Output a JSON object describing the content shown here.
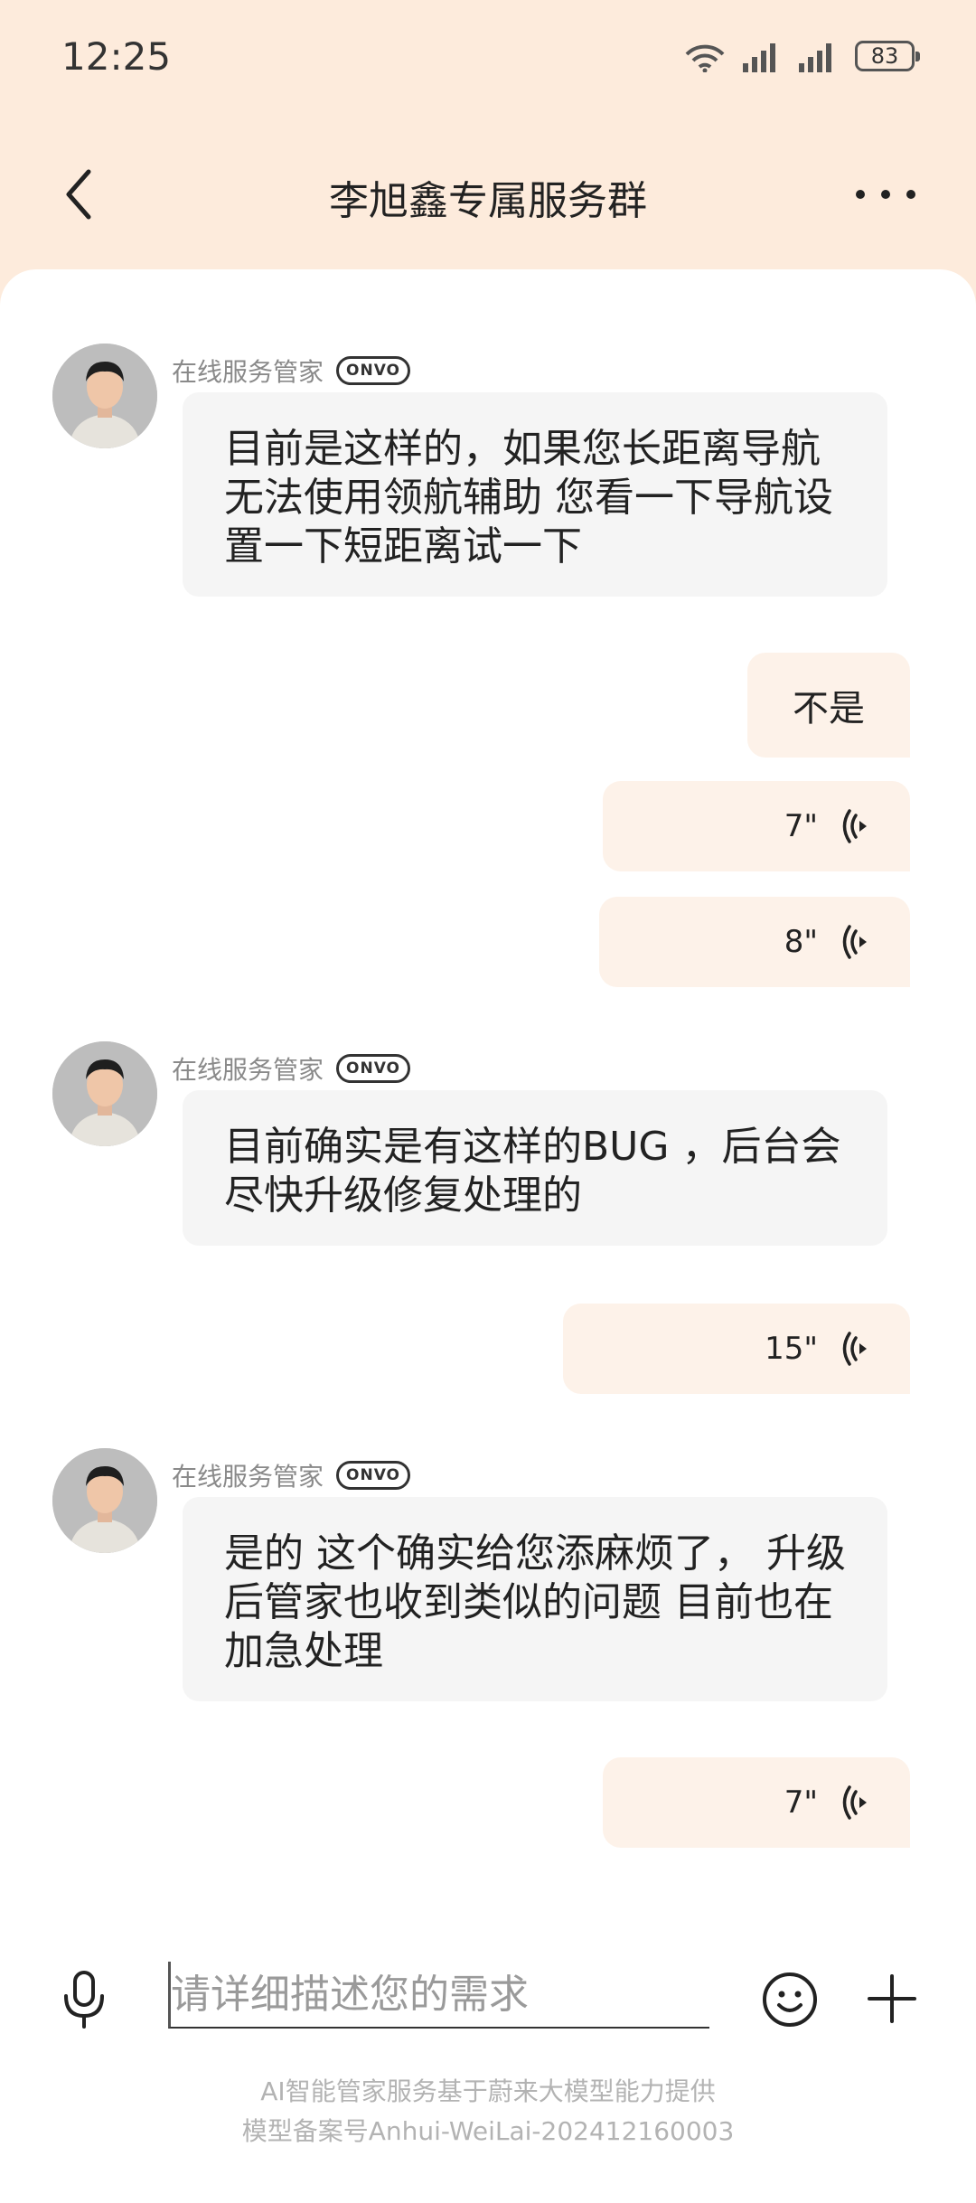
{
  "status_bar": {
    "time": "12:25",
    "battery": "83"
  },
  "header": {
    "title": "李旭鑫专属服务群"
  },
  "messages": [
    {
      "sender": "在线服务管家",
      "badge": "ONVO",
      "text": "目前是这样的，如果您长距离导航无法使用领航辅助 您看一下导航设置一下短距离试一下"
    },
    {
      "text": "不是"
    },
    {
      "duration": "7\""
    },
    {
      "duration": "8\""
    },
    {
      "sender": "在线服务管家",
      "badge": "ONVO",
      "text": "目前确实是有这样的BUG ，后台会尽快升级修复处理的"
    },
    {
      "duration": "15\""
    },
    {
      "sender": "在线服务管家",
      "badge": "ONVO",
      "text": "是的 这个确实给您添麻烦了， 升级后管家也收到类似的问题 目前也在加急处理"
    },
    {
      "duration": "7\""
    }
  ],
  "input": {
    "placeholder": "请详细描述您的需求"
  },
  "footer": {
    "line1": "AI智能管家服务基于蔚来大模型能力提供",
    "line2": "模型备案号Anhui-WeiLai-202412160003"
  },
  "colors": {
    "header_bg": "#fdebdc",
    "outgoing_bubble": "#fdf2e9",
    "incoming_bubble": "#f5f5f5"
  },
  "icons": [
    "wifi-icon",
    "signal-icon",
    "back-icon",
    "more-icon",
    "voice-wave-icon",
    "mic-icon",
    "emoji-icon",
    "plus-icon"
  ]
}
